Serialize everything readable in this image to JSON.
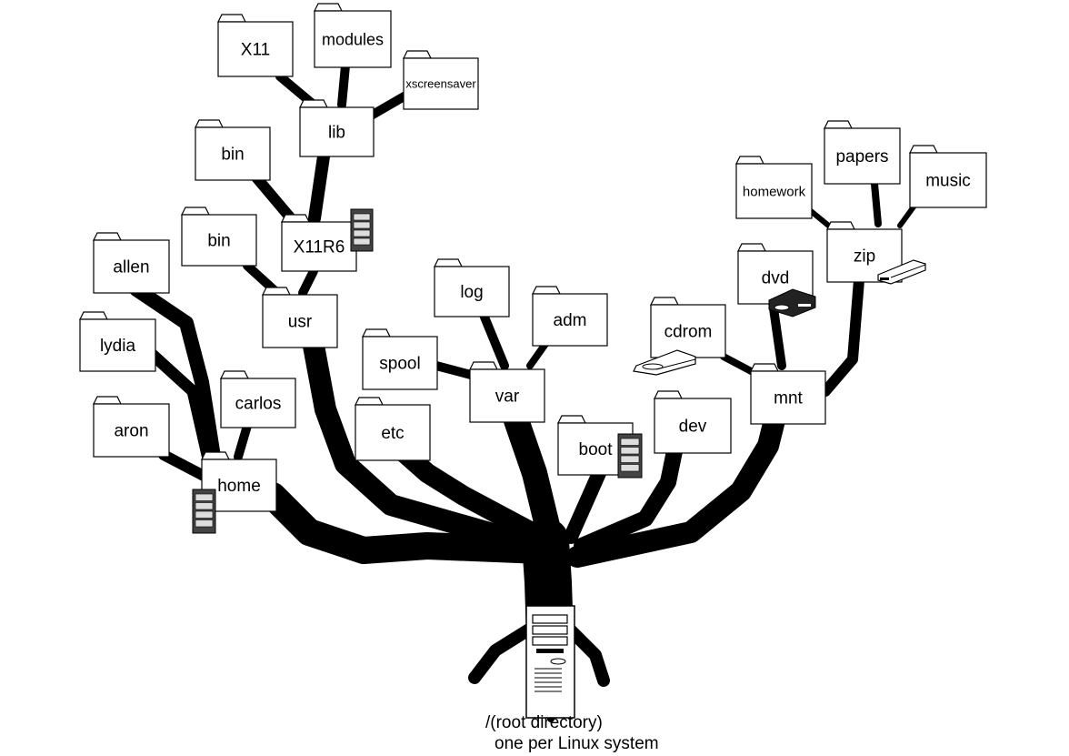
{
  "diagram": {
    "root_caption_line1": "/(root directory)",
    "root_caption_line2": "one per Linux system",
    "folders": {
      "x11": "X11",
      "modules": "modules",
      "xscreensaver": "xscreensaver",
      "lib": "lib",
      "bin_x11r6": "bin",
      "bin_usr": "bin",
      "x11r6": "X11R6",
      "allen": "allen",
      "lydia": "lydia",
      "aron": "aron",
      "carlos": "carlos",
      "home": "home",
      "usr": "usr",
      "log": "log",
      "adm": "adm",
      "spool": "spool",
      "var": "var",
      "etc": "etc",
      "boot": "boot",
      "dev": "dev",
      "cdrom": "cdrom",
      "mnt": "mnt",
      "dvd": "dvd",
      "zip": "zip",
      "homework": "homework",
      "papers": "papers",
      "music": "music"
    },
    "icons": [
      "server-tower-icon",
      "cd-drive-icon",
      "dvd-drive-icon",
      "zip-drive-icon",
      "computer-tower-icon"
    ]
  }
}
